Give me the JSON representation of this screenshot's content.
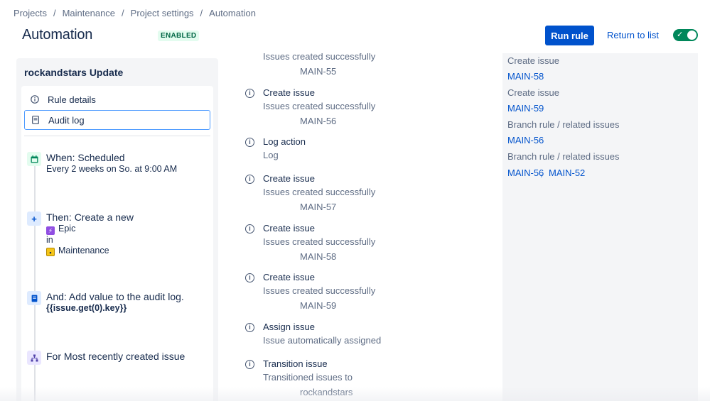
{
  "breadcrumb": {
    "items": [
      "Projects",
      "Maintenance",
      "Project settings",
      "Automation"
    ],
    "separator": "/"
  },
  "header": {
    "title": "Automation",
    "status": "ENABLED",
    "run_label": "Run rule",
    "return_label": "Return to list",
    "toggle_on": true
  },
  "rule": {
    "name": "rockandstars Update",
    "nav": {
      "details": "Rule details",
      "audit": "Audit log"
    },
    "steps": {
      "trigger": {
        "heading": "When: Scheduled",
        "detail": "Every 2 weeks on So. at 9:00 AM"
      },
      "action": {
        "heading": "Then: Create a new",
        "type": "Epic",
        "in": "in",
        "project": "Maintenance"
      },
      "log": {
        "heading": "And: Add value to the audit log.",
        "value": "{{issue.get(0).key}}"
      },
      "branch": {
        "heading": "For Most recently created issue"
      }
    }
  },
  "audit": {
    "top_fragment": "Issues created successfully",
    "top_key": "MAIN-55",
    "entries": [
      {
        "title": "Create issue",
        "desc": "Issues created successfully",
        "key": "MAIN-56"
      },
      {
        "title": "Log action",
        "desc": "Log",
        "key": ""
      },
      {
        "title": "Create issue",
        "desc": "Issues created successfully",
        "key": "MAIN-57"
      },
      {
        "title": "Create issue",
        "desc": "Issues created successfully",
        "key": "MAIN-58"
      },
      {
        "title": "Create issue",
        "desc": "Issues created successfully",
        "key": "MAIN-59"
      },
      {
        "title": "Assign issue",
        "desc": "Issue automatically assigned",
        "key": ""
      },
      {
        "title": "Transition issue",
        "desc": "Transitioned issues to",
        "key": "rockandstars"
      }
    ]
  },
  "related": {
    "label1": "Create issue",
    "link1": "MAIN-58",
    "label2": "Create issue",
    "link2": "MAIN-59",
    "label3": "Branch rule / related issues",
    "link3": "MAIN-56",
    "label4": "Branch rule / related issues",
    "link4a": "MAIN-56",
    "link4sep": ",",
    "link4b": "MAIN-52"
  },
  "colors": {
    "primary": "#0052cc",
    "success": "#00875a",
    "panel": "#f4f5f7"
  }
}
